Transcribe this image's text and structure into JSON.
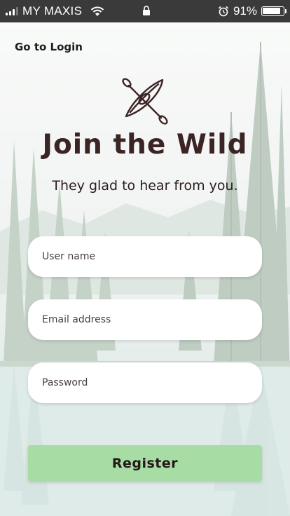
{
  "status_bar": {
    "carrier": "MY MAXIS",
    "battery_percent": "91%",
    "battery_level": 0.91,
    "icons": [
      "signal-icon",
      "wifi-icon",
      "lock-icon",
      "alarm-icon",
      "battery-icon"
    ]
  },
  "nav": {
    "back_label": "Go to Login"
  },
  "header": {
    "logo_icon": "kayak-paddle-icon",
    "title": "Join the Wild",
    "subtitle": "They glad to hear from you."
  },
  "form": {
    "username": {
      "value": "",
      "placeholder": "User name"
    },
    "email": {
      "value": "",
      "placeholder": "Email address"
    },
    "password": {
      "value": "",
      "placeholder": "Password"
    },
    "submit_label": "Register"
  },
  "colors": {
    "title": "#3b2424",
    "button_bg": "#a8dca5",
    "status_bar_bg": "#3a3a3a"
  }
}
